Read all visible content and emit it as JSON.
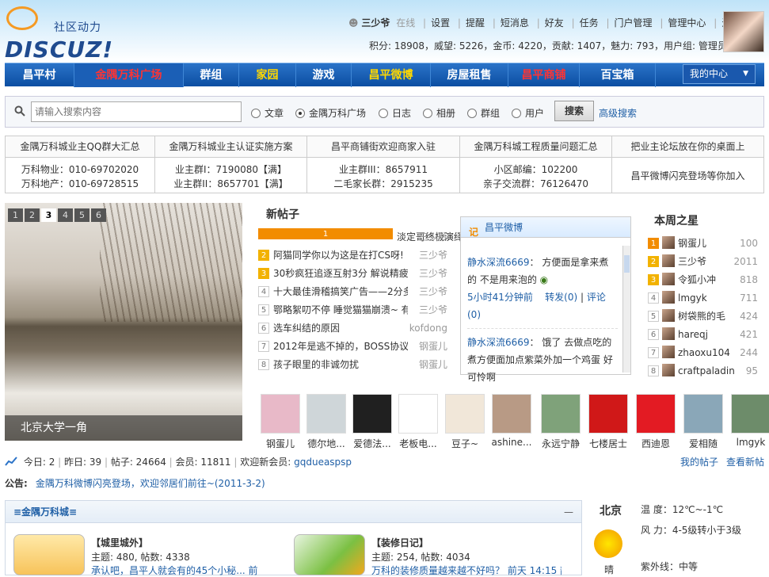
{
  "header": {
    "logo_cn": "社区动力",
    "logo_en": "DISCUZ!",
    "username": "三少爷",
    "online": "在线",
    "menu": [
      "设置",
      "提醒",
      "短消息",
      "好友",
      "任务",
      "门户管理",
      "管理中心",
      "退出"
    ],
    "stats": "积分: 18908，威望: 5226，金币: 4220，贡献: 1407，魅力: 793，用户组: 管理员"
  },
  "nav": {
    "items": [
      {
        "label": "昌平村"
      },
      {
        "label": "金隅万科广场"
      },
      {
        "label": "群组"
      },
      {
        "label": "家园"
      },
      {
        "label": "游戏"
      },
      {
        "label": "昌平微博"
      },
      {
        "label": "房屋租售"
      },
      {
        "label": "昌平商铺"
      },
      {
        "label": "百宝箱"
      }
    ],
    "my_center": "我的中心"
  },
  "search": {
    "placeholder": "请输入搜索内容",
    "options": [
      "文章",
      "金隅万科广场",
      "日志",
      "相册",
      "群组",
      "用户"
    ],
    "button": "搜索",
    "advanced": "高级搜索"
  },
  "links": [
    {
      "head": "金隅万科城业主QQ群大汇总",
      "lines": [
        "万科物业：010-69702020",
        "万科地产：010-69728515"
      ]
    },
    {
      "head": "金隅万科城业主认证实施方案",
      "lines": [
        "业主群I：7190080【满】",
        "业主群II：8657701【满】"
      ]
    },
    {
      "head": "昌平商铺街欢迎商家入驻",
      "lines": [
        "业主群III：8657911",
        "二毛家长群：2915235"
      ]
    },
    {
      "head": "金隅万科城工程质量问题汇总",
      "lines": [
        "小区邮编：102200",
        "亲子交流群：76126470"
      ]
    },
    {
      "head": "把业主论坛放在你的桌面上",
      "lines": [
        "昌平微博闪亮登场等你加入"
      ]
    }
  ],
  "slide": {
    "pages": [
      "1",
      "2",
      "3",
      "4",
      "5",
      "6"
    ],
    "active": "3",
    "caption": "北京大学一角"
  },
  "new_posts": {
    "title": "新帖子",
    "items": [
      {
        "n": "1",
        "t": "淡定哥终极演绎淡定的精髓",
        "a": "三少爷"
      },
      {
        "n": "2",
        "t": "阿猫同学你以为这是在打CS呀!",
        "a": "三少爷"
      },
      {
        "n": "3",
        "t": "30秒疯狂追逐互射3分 解说精疲",
        "a": "三少爷"
      },
      {
        "n": "4",
        "t": "十大最佳滑稽搞笑广告——2分多",
        "a": "三少爷"
      },
      {
        "n": "5",
        "t": "鄂略絮叨不停 睡觉猫猫崩溃~ 有",
        "a": "三少爷"
      },
      {
        "n": "6",
        "t": "选车纠结的原因",
        "a": "kofdong"
      },
      {
        "n": "7",
        "t": "2012年是逃不掉的，BOSS协议",
        "a": "钢蛋儿"
      },
      {
        "n": "8",
        "t": "孩子眼里的非诚勿扰",
        "a": "钢蛋儿"
      }
    ]
  },
  "weibo": {
    "title": "昌平微博",
    "post1_user": "静水深流6669",
    "post1_text": "方便面是拿来煮的 不是用来泡的",
    "post1_time": "5小时41分钟前",
    "post1_fwd": "转发(0)",
    "post1_cmt": "评论(0)",
    "post2_user": "静水深流6669",
    "post2_text": "饿了 去做点吃的 煮方便面加点紫菜外加一个鸡蛋 好可怜啊"
  },
  "stars": {
    "title": "本周之星",
    "items": [
      {
        "n": "1",
        "name": "钢蛋儿",
        "v": "100"
      },
      {
        "n": "2",
        "name": "三少爷",
        "v": "2011"
      },
      {
        "n": "3",
        "name": "令狐小冲",
        "v": "818"
      },
      {
        "n": "4",
        "name": "lmgyk",
        "v": "711"
      },
      {
        "n": "5",
        "name": "树袋熊的毛",
        "v": "424"
      },
      {
        "n": "6",
        "name": "hareqj",
        "v": "421"
      },
      {
        "n": "7",
        "name": "zhaoxu104",
        "v": "244"
      },
      {
        "n": "8",
        "name": "craftpaladin",
        "v": "95"
      }
    ]
  },
  "members": [
    {
      "name": "钢蛋儿",
      "color": "#e8b9c8"
    },
    {
      "name": "德尔地...",
      "color": "#cfd6d9"
    },
    {
      "name": "爱德法...",
      "color": "#202020"
    },
    {
      "name": "老板电...",
      "color": "#ffffff"
    },
    {
      "name": "豆子~",
      "color": "#f1e7d9"
    },
    {
      "name": "ashine...",
      "color": "#b89a85"
    },
    {
      "name": "永远宁静",
      "color": "#7fa27a"
    },
    {
      "name": "七楼居士",
      "color": "#d01818"
    },
    {
      "name": "西迪恩",
      "color": "#e31b23"
    },
    {
      "name": "爱相随",
      "color": "#8aa7b8"
    },
    {
      "name": "lmgyk",
      "color": "#6d8c6a"
    }
  ],
  "statbar": {
    "today_l": "今日: ",
    "today": "2",
    "yest_l": "昨日: ",
    "yest": "39",
    "posts_l": "帖子: ",
    "posts": "24664",
    "mem_l": "会员: ",
    "mem": "11811",
    "welcome": "欢迎新会员: ",
    "newuser": "gqdueaspsp",
    "my_posts": "我的帖子",
    "new_posts": "查看新帖"
  },
  "notice": {
    "label": "公告:",
    "text": "金隅万科微博闪亮登场，欢迎邻居们前往~(2011-3-2)"
  },
  "forum": {
    "title": "≡金隅万科城≡",
    "collapse": "—",
    "boards": [
      {
        "title": "【城里城外】",
        "stats": "主题: 480, 帖数: 4338",
        "last": "承认吧，昌平人就会有的45个小秘... 前"
      },
      {
        "title": "【装修日记】",
        "stats": "主题: 254, 帖数: 4034",
        "last": "万科的装修质量越来越不好吗？ 前天 14:15 静"
      }
    ]
  },
  "weather": {
    "city": "北京",
    "temp": "温   度：12℃~-1℃",
    "wind": "风   力：4-5级转小于3级",
    "uv": "紫外线：中等",
    "cond": "晴"
  }
}
